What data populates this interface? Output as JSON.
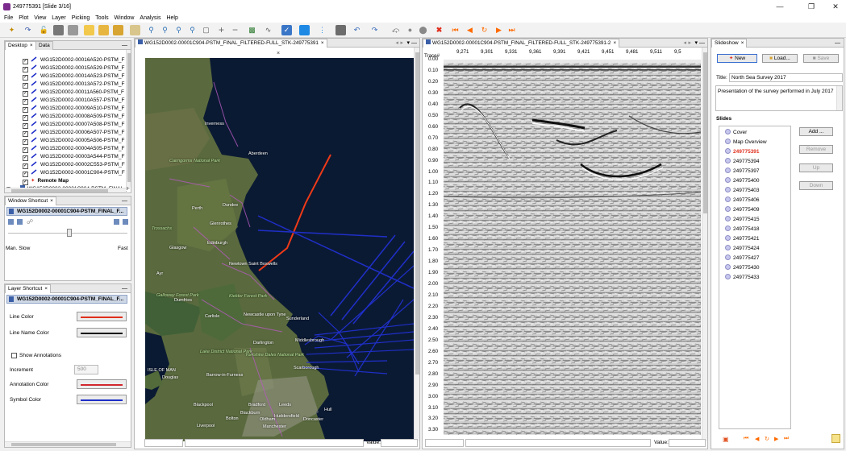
{
  "window": {
    "title": "249775391 [Slide 3/16]"
  },
  "menu": [
    "File",
    "Plot",
    "View",
    "Layer",
    "Picking",
    "Tools",
    "Window",
    "Analysis",
    "Help"
  ],
  "desktop_panel": {
    "tabs": [
      "Desktop",
      "Data"
    ],
    "items": [
      "WG152D0002-00016A520-PSTM_F",
      "WG152D0002-00015A529-PSTM_F",
      "WG152D0002-00014A523-PSTM_F",
      "WG152D0002-00013A572-PSTM_F",
      "WG152D0002-00011A560-PSTM_F",
      "WG152D0002-00010A557-PSTM_F",
      "WG152D0002-00009A510-PSTM_F",
      "WG152D0002-00008A509-PSTM_F",
      "WG152D0002-00007A508-PSTM_F",
      "WG152D0002-00006A507-PSTM_F",
      "WG152D0002-00005A506-PSTM_F",
      "WG152D0002-00004A505-PSTM_F",
      "WG152D0002-00003A544-PSTM_F",
      "WG152D0002-00002C553-PSTM_F",
      "WG152D0002-00001C904-PSTM_F"
    ],
    "remote_map": "Remote Map",
    "bottom_item": "WG152D0002-00001C904-PSTM_FINAL_F"
  },
  "window_shortcut": {
    "title": "Window Shortcut",
    "selected": "WG152D0002-00001C904-PSTM_FINAL_F...",
    "slider_min": "Man. Slow",
    "slider_max": "Fast"
  },
  "layer_shortcut": {
    "title": "Layer Shortcut",
    "selected": "WG152D0002-00001C904-PSTM_FINAL_F...",
    "line_color_label": "Line Color",
    "line_name_color_label": "Line Name Color",
    "show_annotations_label": "Show Annotations",
    "increment_label": "Increment",
    "increment_value": "500",
    "annotation_color_label": "Annotation Color",
    "symbol_color_label": "Symbol Color",
    "colors": {
      "line": "#e0301e",
      "line_name": "#000000",
      "annotation": "#d2262e",
      "symbol": "#1f2fc8"
    }
  },
  "map_view": {
    "tab_title": "WG152D0002-00001C904-PSTM_FINAL_FILTERED-FULL_STK-249775391",
    "labels": [
      "Inverness",
      "Aberdeen",
      "Cairngorms National Park",
      "Dundee",
      "Perth",
      "Glenrothes",
      "Trossachs",
      "Edinburgh",
      "Glasgow",
      "Newtown Saint Boswells",
      "Ayr",
      "Galloway Forest Park",
      "Dumfries",
      "Kielder Forest Park",
      "Carlisle",
      "Newcastle upon Tyne",
      "Sunderland",
      "Middlesbrough",
      "Darlington",
      "Lake District National Park",
      "ISLE OF MAN",
      "Douglas",
      "Yorkshire Dales National Park",
      "Scarborough",
      "Barrow-in-Furness",
      "Blackpool",
      "Bradford",
      "Leeds",
      "Hull",
      "Huddersfield",
      "Blackburn",
      "Bolton",
      "Oldham",
      "Doncaster",
      "Liverpool",
      "Manchester"
    ],
    "status_label": "Value:"
  },
  "seismic_view": {
    "tab_title": "WG152D0002-00001C904-PSTM_FINAL_FILTERED-FULL_STK-249775391-2",
    "trace_label": "Trace#",
    "trace_ticks": [
      "9,271",
      "9,301",
      "9,331",
      "9,361",
      "9,391",
      "9,421",
      "9,451",
      "9,481",
      "9,511",
      "9,5"
    ],
    "time_ticks": [
      "0.00",
      "0.10",
      "0.20",
      "0.30",
      "0.40",
      "0.50",
      "0.60",
      "0.70",
      "0.80",
      "0.90",
      "1.00",
      "1.10",
      "1.20",
      "1.30",
      "1.40",
      "1.50",
      "1.60",
      "1.70",
      "1.80",
      "1.90",
      "2.00",
      "2.10",
      "2.20",
      "2.30",
      "2.40",
      "2.50",
      "2.60",
      "2.70",
      "2.80",
      "2.90",
      "3.00",
      "3.10",
      "3.20",
      "3.30"
    ],
    "status_label": "Value:"
  },
  "slideshow": {
    "tab": "Slideshow",
    "new_label": "New",
    "load_label": "Load...",
    "save_label": "Save",
    "title_label": "Title:",
    "title_value": "North Sea Survey 2017",
    "description": "Presentation of the survey performed in July 2017",
    "slides_label": "Slides",
    "slides": [
      "Cover",
      "Map Overview",
      "249775391",
      "249775394",
      "249775397",
      "249775400",
      "249775403",
      "249775406",
      "249775409",
      "249775415",
      "249775418",
      "249775421",
      "249775424",
      "249775427",
      "249775430",
      "249775433"
    ],
    "current_slide_index": 2,
    "add_label": "Add ...",
    "remove_label": "Remove",
    "up_label": "Up",
    "down_label": "Down"
  }
}
